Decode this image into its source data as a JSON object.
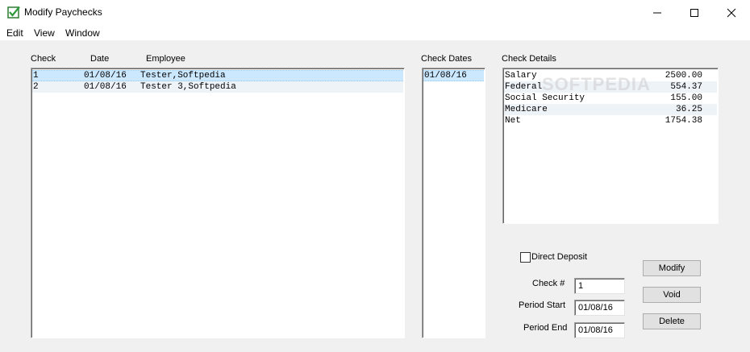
{
  "window": {
    "title": "Modify Paychecks",
    "app_icon": "checkbook-icon"
  },
  "menu": [
    "Edit",
    "View",
    "Window"
  ],
  "checks_list": {
    "headers": {
      "check": "Check",
      "date": "Date",
      "employee": "Employee"
    },
    "rows": [
      {
        "check": "1",
        "date": "01/08/16",
        "employee": "Tester,Softpedia"
      },
      {
        "check": "2",
        "date": "01/08/16",
        "employee": "Tester 3,Softpedia"
      }
    ]
  },
  "check_dates": {
    "header": "Check Dates",
    "items": [
      "01/08/16"
    ]
  },
  "check_details": {
    "header": "Check Details",
    "watermark": "SOFTPEDIA",
    "rows": [
      {
        "label": "Salary",
        "value": "2500.00"
      },
      {
        "label": "Federal",
        "value": "554.37"
      },
      {
        "label": "Social Security",
        "value": "155.00"
      },
      {
        "label": "Medicare",
        "value": "36.25"
      },
      {
        "label": "Net",
        "value": "1754.38"
      }
    ]
  },
  "form": {
    "direct_deposit_label": "Direct Deposit",
    "direct_deposit_checked": false,
    "check_num_label": "Check #",
    "check_num_value": "1",
    "period_start_label": "Period Start",
    "period_start_value": "01/08/16",
    "period_end_label": "Period End",
    "period_end_value": "01/08/16"
  },
  "buttons": {
    "modify": "Modify",
    "void": "Void",
    "delete": "Delete"
  },
  "colors": {
    "selection": "#cce8ff",
    "alt_row": "#eef3f8"
  }
}
